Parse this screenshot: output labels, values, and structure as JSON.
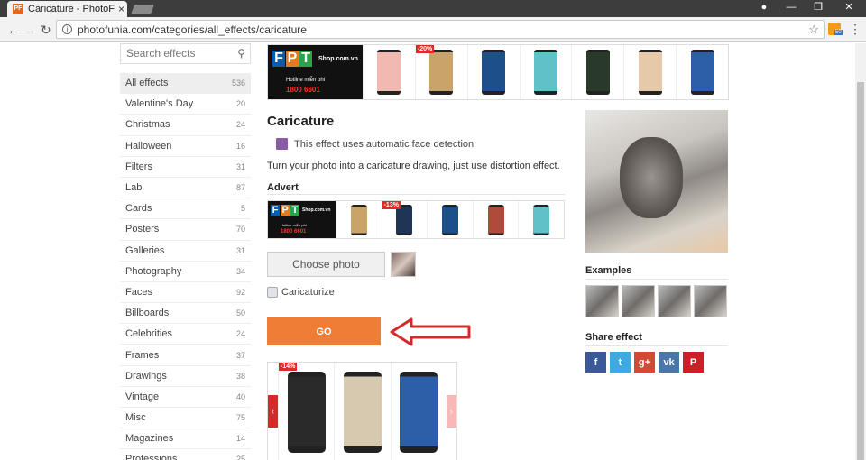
{
  "browser": {
    "tab_title": "Caricature - PhotoFunia",
    "tab_close": "×",
    "favicon_text": "PF",
    "url": "photofunia.com/categories/all_effects/caricature",
    "rss_badge": "50"
  },
  "search": {
    "placeholder": "Search effects"
  },
  "sidebar": {
    "items": [
      {
        "label": "All effects",
        "count": "536",
        "active": true
      },
      {
        "label": "Valentine's Day",
        "count": "20"
      },
      {
        "label": "Christmas",
        "count": "24"
      },
      {
        "label": "Halloween",
        "count": "16"
      },
      {
        "label": "Filters",
        "count": "31"
      },
      {
        "label": "Lab",
        "count": "87"
      },
      {
        "label": "Cards",
        "count": "5"
      },
      {
        "label": "Posters",
        "count": "70"
      },
      {
        "label": "Galleries",
        "count": "31"
      },
      {
        "label": "Photography",
        "count": "34"
      },
      {
        "label": "Faces",
        "count": "92"
      },
      {
        "label": "Billboards",
        "count": "50"
      },
      {
        "label": "Celebrities",
        "count": "24"
      },
      {
        "label": "Frames",
        "count": "37"
      },
      {
        "label": "Drawings",
        "count": "38"
      },
      {
        "label": "Vintage",
        "count": "40"
      },
      {
        "label": "Misc",
        "count": "75"
      },
      {
        "label": "Magazines",
        "count": "14"
      },
      {
        "label": "Professions",
        "count": "25"
      }
    ]
  },
  "ad_top": {
    "logo": [
      "F",
      "P",
      "T"
    ],
    "shop": "Shop.com.vn",
    "hotline": "Hotline miễn phí",
    "phone": "1800 6601",
    "discount": "-20%",
    "phone_colors": [
      "#f2b9b0",
      "#c9a36a",
      "#1d4f8a",
      "#5fc2c9",
      "#2a3a2a",
      "#e6c9a8",
      "#2d5fa8"
    ]
  },
  "effect": {
    "title": "Caricature",
    "face_note": "This effect uses automatic face detection",
    "description": "Turn your photo into a caricature drawing, just use distortion effect.",
    "advert_label": "Advert",
    "choose_button": "Choose photo",
    "checkbox_label": "Caricaturize",
    "go_button": "GO"
  },
  "ad_mid": {
    "discount": "-13%",
    "phone_colors": [
      "#c9a36a",
      "#1f3555",
      "#1d4f8a",
      "#b04a3a",
      "#5fc2c9"
    ]
  },
  "ad_bot": {
    "discount": "-14%",
    "prev": "‹",
    "next": "›",
    "phone_colors": [
      "#2a2a2a",
      "#d7c9b0",
      "#2d5fa8"
    ]
  },
  "right": {
    "examples_label": "Examples",
    "share_label": "Share effect",
    "share_buttons": [
      {
        "label": "f",
        "color": "#3b5998"
      },
      {
        "label": "t",
        "color": "#3fa9e0"
      },
      {
        "label": "g+",
        "color": "#d24a35"
      },
      {
        "label": "vk",
        "color": "#4a76a8"
      },
      {
        "label": "P",
        "color": "#cb2027"
      }
    ]
  },
  "colors": {
    "accent": "#f07d35",
    "arrow": "#d42a2a"
  }
}
